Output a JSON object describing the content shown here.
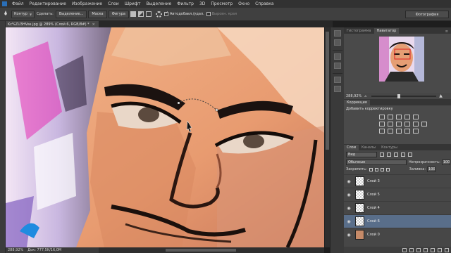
{
  "menubar": {
    "items": [
      "Файл",
      "Редактирование",
      "Изображение",
      "Слои",
      "Шрифт",
      "Выделение",
      "Фильтр",
      "3D",
      "Просмотр",
      "Окно",
      "Справка"
    ]
  },
  "options": {
    "mode": "Контур",
    "make_label": "Сделать:",
    "selection_btn": "Выделение...",
    "mask_btn": "Маска",
    "shape_btn": "Фигура",
    "autoadd_label": "Автодобавл./удал.",
    "align_edges_label": "Выровн. края",
    "workspace": "Фотография"
  },
  "document": {
    "tab_title": "Kc%ZU3HVas.jpg @ 289% (Слой 6, RGB/8#) *",
    "zoom": "288,92%",
    "doc_size": "Док: 777,5K/16,0M"
  },
  "panels": {
    "top_tabs": [
      "Гистограмма",
      "Навигатор"
    ],
    "navigator_zoom": "288,92%",
    "adjustments_tab": "Коррекция",
    "adjustments_title": "Добавить корректировку",
    "layers_tabs": [
      "Слои",
      "Каналы",
      "Контуры"
    ],
    "kind_label": "Вид",
    "blend_mode": "Обычные",
    "opacity_label": "Непрозрачность:",
    "opacity_value": "100%",
    "lock_label": "Закрепить:",
    "fill_label": "Заливка:",
    "fill_value": "100%",
    "layers": [
      {
        "name": "Слой 3",
        "selected": false
      },
      {
        "name": "Слой 5",
        "selected": false
      },
      {
        "name": "Слой 4",
        "selected": false
      },
      {
        "name": "Слой 6",
        "selected": true
      },
      {
        "name": "Слой 0",
        "selected": false
      }
    ]
  }
}
